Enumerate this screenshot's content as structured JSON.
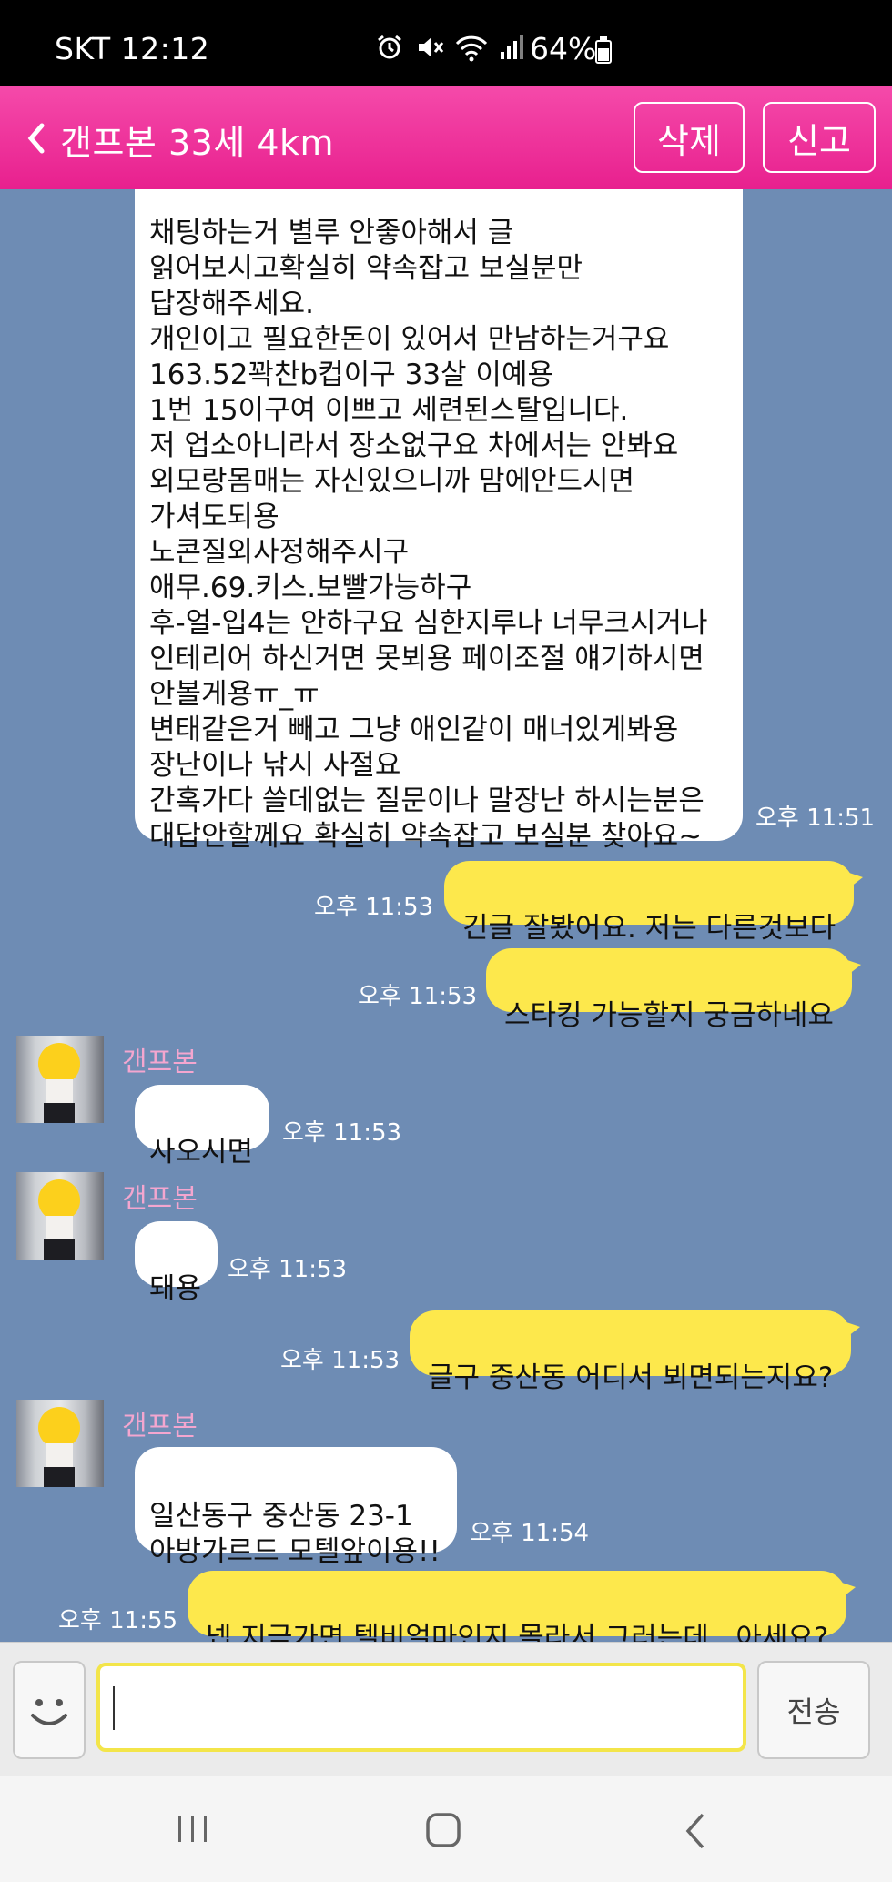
{
  "status_bar": {
    "carrier_time": "SKT 12:12",
    "battery": "64%"
  },
  "header": {
    "title": "갠프본 33세 4km",
    "delete_label": "삭제",
    "report_label": "신고",
    "color": "#ef3aa0"
  },
  "messages": [
    {
      "side": "in",
      "text": "채팅하는거 별루 안좋아해서 글\n읽어보시고확실히 약속잡고 보실분만\n답장해주세요.\n개인이고 필요한돈이 있어서 만남하는거구요\n163.52꽉찬b컵이구 33살 이예용\n1번 15이구여 이쁘고 세련된스탈입니다.\n저 업소아니라서 장소없구요 차에서는 안봐요\n외모랑몸매는 자신있으니까 맘에안드시면\n가셔도되용\n노콘질외사정해주시구\n애무.69.키스.보빨가능하구\n후-얼-입4는 안하구요 심한지루나 너무크시거나\n인테리어 하신거면 못뵈용 페이조절 얘기하시면\n안볼게용ㅠ_ㅠ\n변태같은거 빼고 그냥 애인같이 매너있게봐용\n장난이나 낚시 사절요\n간혹가다 쓸데없는 질문이나 말장난 하시는분은\n대답안할께요 확실히 약속잡고 보실분 찾아요~",
      "time": "오후 11:51"
    },
    {
      "side": "out",
      "text": "긴글 잘봤어요. 저는 다른것보다",
      "time": "오후 11:53"
    },
    {
      "side": "out",
      "text": "스타킹 가능할지 궁금하네요",
      "time": "오후 11:53"
    },
    {
      "side": "in",
      "sender": "갠프본",
      "text": "사오시면",
      "time": "오후 11:53"
    },
    {
      "side": "in",
      "sender": "갠프본",
      "text": "돼용",
      "time": "오후 11:53"
    },
    {
      "side": "out",
      "text": "글구 중산동 어디서 뵈면되는지요?",
      "time": "오후 11:53"
    },
    {
      "side": "in",
      "sender": "갠프본",
      "text": "일산동구 중산동 23-1\n아방가르드 모텔앞이용!!",
      "time": "오후 11:54"
    },
    {
      "side": "out",
      "text": "넵 지금가면 텔비얼마인지 몰라서 그러는데.. 아세요?",
      "time": "오후 11:55"
    }
  ],
  "input": {
    "value": "",
    "send_label": "전송"
  },
  "icons": [
    "back-chevron-icon",
    "alarm-icon",
    "mute-icon",
    "wifi-icon",
    "signal-icon",
    "battery-icon",
    "emoji-icon",
    "recent-apps-icon",
    "home-icon",
    "nav-back-icon"
  ]
}
